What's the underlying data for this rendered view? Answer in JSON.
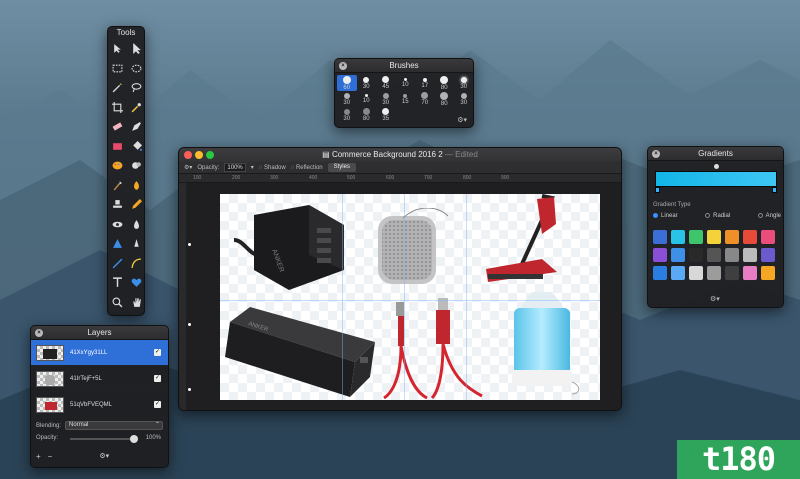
{
  "tools": {
    "title": "Tools",
    "icons": [
      "arrow-icon",
      "pointer-icon",
      "rect-select-icon",
      "ellipse-select-icon",
      "magic-wand-icon",
      "lasso-icon",
      "crop-icon",
      "eyedropper-icon",
      "eraser-icon",
      "pen-icon",
      "rectangle-icon",
      "paint-bucket-icon",
      "palette-icon",
      "blob-icon",
      "brush-icon",
      "smudge-icon",
      "stamp-icon",
      "pencil-icon",
      "eye-icon",
      "drop-icon",
      "triangle-icon",
      "sharpen-icon",
      "line-icon",
      "bezier-icon",
      "text-icon",
      "heart-icon",
      "zoom-icon",
      "hand-icon"
    ]
  },
  "brushes": {
    "title": "Brushes",
    "row1": [
      "60",
      "30",
      "45",
      "10",
      "17",
      "80",
      "30"
    ],
    "row2": [
      "30",
      "10",
      "30",
      "15",
      "70",
      "80",
      "30"
    ],
    "row3": [
      "30",
      "80",
      "35"
    ]
  },
  "main": {
    "title": "Commerce Background 2016 2",
    "edited": "— Edited",
    "opacity_label": "Opacity:",
    "opacity_value": "100%",
    "shadow": "Shadow",
    "reflection": "Reflection",
    "styles": "Styles",
    "ruler": [
      "100",
      "200",
      "300",
      "400",
      "500",
      "600",
      "700",
      "800",
      "900"
    ]
  },
  "gradients": {
    "title": "Gradients",
    "type_label": "Gradient Type",
    "linear": "Linear",
    "radial": "Radial",
    "angle": "Angle",
    "swatch_colors": [
      "#3b6fd6",
      "#29c3e8",
      "#3ec46a",
      "#f5d23a",
      "#ef8f2a",
      "#e84a3a",
      "#ea4d7a",
      "#8b4ed6",
      "#3d8fe8",
      "#2a2a2a",
      "#555555",
      "#888888",
      "#bbbbbb",
      "#6a5acd",
      "#2a7de1",
      "#5aa9f7",
      "#d8d8d8",
      "#9c9c9c",
      "#3f3f3f",
      "#e77ec4",
      "#f5a623"
    ]
  },
  "layers": {
    "title": "Layers",
    "items": [
      {
        "name": "41XxYgy31LL",
        "selected": true
      },
      {
        "name": "41IrTejF+5L",
        "selected": false
      },
      {
        "name": "51qVbFVEQML",
        "selected": false
      }
    ],
    "blending_label": "Blending:",
    "blending_value": "Normal",
    "opacity_label": "Opacity:",
    "opacity_value": "100%",
    "add": "+",
    "remove": "−"
  },
  "watermark": "t180"
}
